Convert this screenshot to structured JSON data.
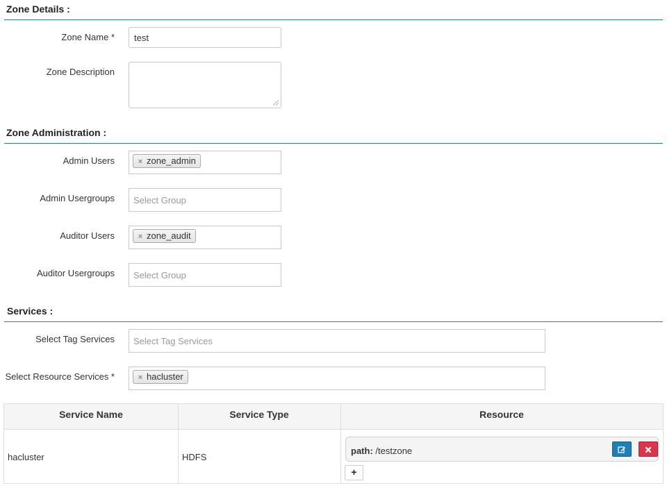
{
  "zone_details": {
    "title": "Zone Details :",
    "zone_name_label": "Zone Name *",
    "zone_name_value": "test",
    "zone_description_label": "Zone Description",
    "zone_description_value": ""
  },
  "zone_admin": {
    "title": "Zone Administration :",
    "admin_users_label": "Admin Users",
    "admin_users": [
      "zone_admin"
    ],
    "admin_groups_label": "Admin Usergroups",
    "admin_groups_placeholder": "Select Group",
    "auditor_users_label": "Auditor Users",
    "auditor_users": [
      "zone_audit"
    ],
    "auditor_groups_label": "Auditor Usergroups",
    "auditor_groups_placeholder": "Select Group"
  },
  "services": {
    "title": "Services :",
    "tag_services_label": "Select Tag Services",
    "tag_services_placeholder": "Select Tag Services",
    "resource_services_label": "Select Resource Services *",
    "resource_services": [
      "hacluster"
    ],
    "table": {
      "headers": [
        "Service Name",
        "Service Type",
        "Resource"
      ],
      "rows": [
        {
          "service_name": "hacluster",
          "service_type": "HDFS",
          "resource_key": "path:",
          "resource_value": "/testzone"
        }
      ]
    },
    "add_symbol": "+",
    "edit_icon": "edit-icon",
    "delete_icon": "delete-icon",
    "remove_tag_symbol": "×"
  },
  "colors": {
    "section_rule": "#2e7d8f",
    "edit_button": "#1f7fb4",
    "delete_button": "#d9354f"
  }
}
